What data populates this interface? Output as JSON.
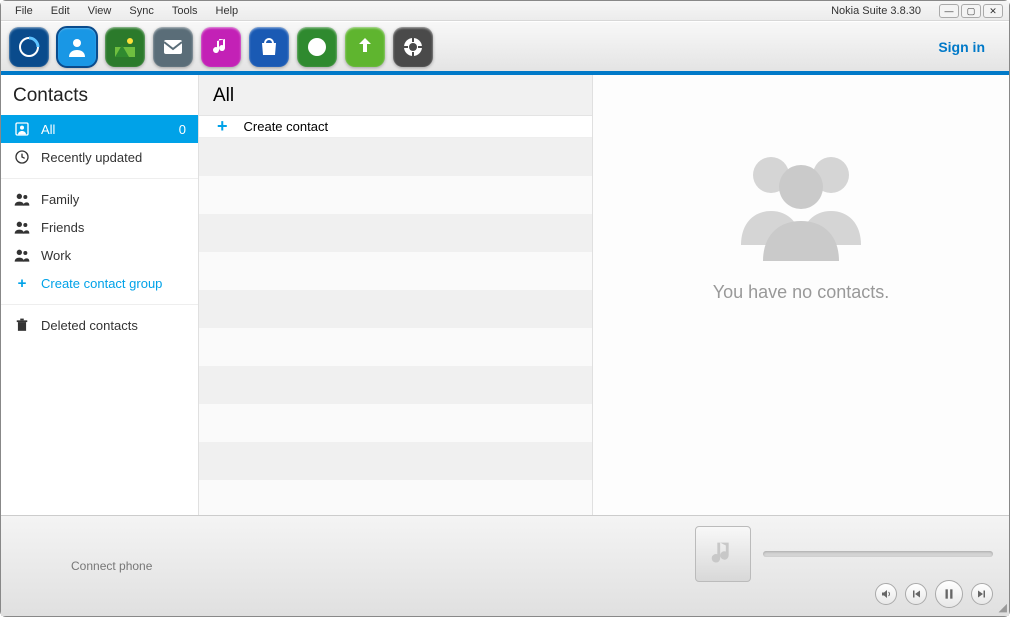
{
  "app": {
    "title": "Nokia Suite 3.8.30",
    "signin": "Sign in"
  },
  "menu": [
    "File",
    "Edit",
    "View",
    "Sync",
    "Tools",
    "Help"
  ],
  "toolbar_icons": [
    {
      "name": "home",
      "color": "#0a4b8c"
    },
    {
      "name": "contacts",
      "color": "#1997e5"
    },
    {
      "name": "gallery",
      "color": "#2b7a2b"
    },
    {
      "name": "messaging",
      "color": "#5a6d78"
    },
    {
      "name": "music",
      "color": "#c321b6"
    },
    {
      "name": "store",
      "color": "#1a5ab4"
    },
    {
      "name": "maps",
      "color": "#2f8a2f"
    },
    {
      "name": "update",
      "color": "#5fb52f"
    },
    {
      "name": "support",
      "color": "#4a4a4a"
    }
  ],
  "sidebar": {
    "title": "Contacts",
    "all": {
      "label": "All",
      "count": "0"
    },
    "recent": {
      "label": "Recently updated"
    },
    "groups": [
      "Family",
      "Friends",
      "Work"
    ],
    "create_group": "Create contact group",
    "deleted": "Deleted contacts"
  },
  "list": {
    "header": "All",
    "create": "Create contact"
  },
  "detail": {
    "empty": "You have no contacts."
  },
  "footer": {
    "connect": "Connect phone"
  }
}
